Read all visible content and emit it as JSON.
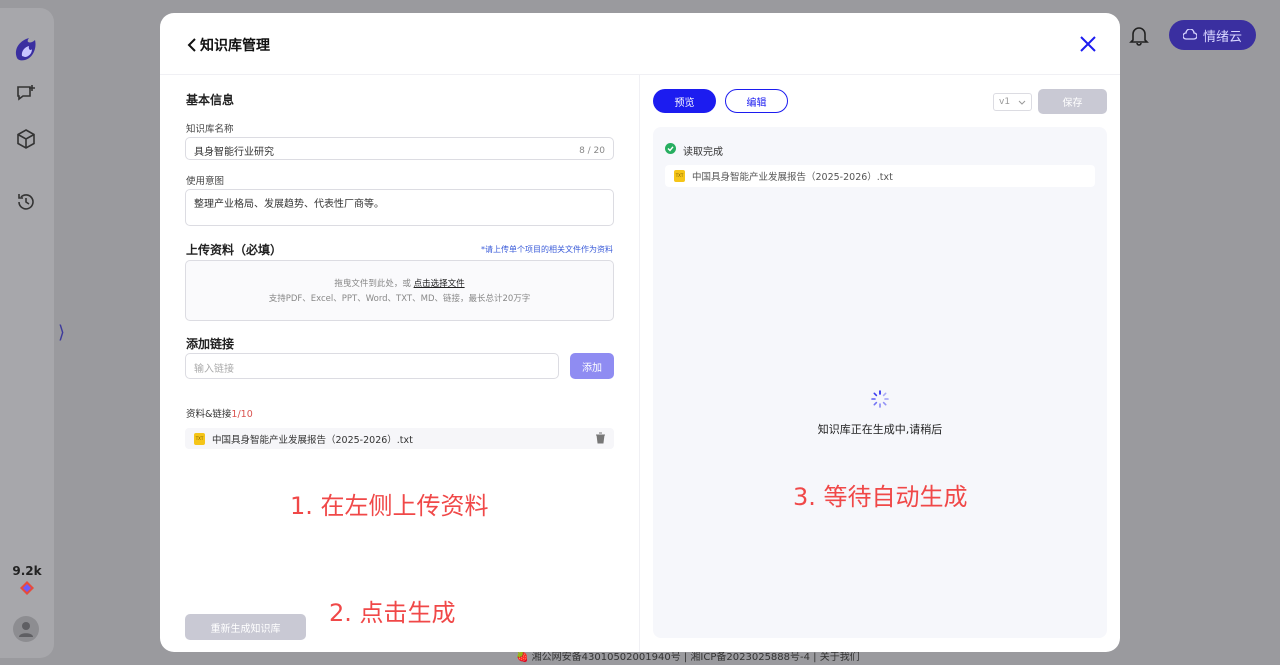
{
  "background": {
    "count_badge": "9.2k",
    "cloud_button": "情绪云",
    "footer": "🍓 湘公网安备43010502001940号 | 湘ICP备2023025888号-4 | 关于我们"
  },
  "modal": {
    "title": "知识库管理",
    "basic_info": "基本信息",
    "name_label": "知识库名称",
    "name_value": "具身智能行业研究",
    "name_counter": "8 / 20",
    "intent_label": "使用意图",
    "intent_value": "整理产业格局、发展趋势、代表性厂商等。",
    "upload_title": "上传资料（必填）",
    "upload_hint": "*请上传单个项目的相关文件作为资料",
    "upload_drop_text": "拖曳文件到此处，或 ",
    "upload_link": "点击选择文件",
    "upload_formats": "支持PDF、Excel、PPT、Word、TXT、MD、链接，最长总计20万字",
    "link_title": "添加链接",
    "link_placeholder": "输入链接",
    "add_button": "添加",
    "resources_label": "资料&链接",
    "resources_count": "1/10",
    "files": [
      {
        "name": "中国具身智能产业发展报告（2025-2026）.txt",
        "type": "TXT"
      }
    ],
    "annotation_1": "1. 在左侧上传资料",
    "annotation_2": "2. 点击生成",
    "annotation_3": "3. 等待自动生成",
    "regenerate_button": "重新生成知识库",
    "preview_tab": "预览",
    "edit_tab": "编辑",
    "version": "v1",
    "save_button": "保存",
    "read_status": "读取完成",
    "generating_text": "知识库正在生成中,请稍后"
  },
  "colors": {
    "primary": "#1c1cf0",
    "accent_soft": "#8f8cf2",
    "annotation": "#f04848",
    "success": "#27ae60"
  }
}
